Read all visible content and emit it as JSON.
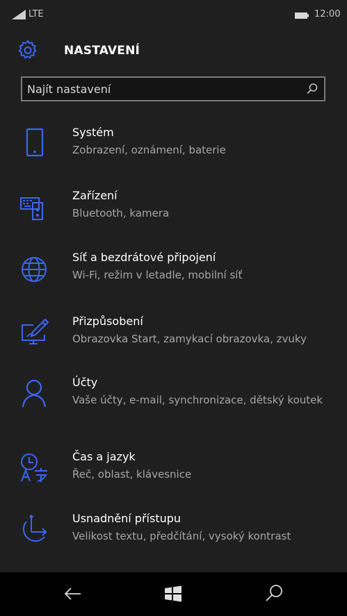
{
  "status_bar": {
    "network": "LTE",
    "time": "12:00"
  },
  "header": {
    "title": "NASTAVENÍ",
    "icon": "gear-icon"
  },
  "search": {
    "placeholder": "Najít nastavení",
    "icon": "search-icon"
  },
  "settings": [
    {
      "icon": "phone-icon",
      "title": "Systém",
      "subtitle": "Zobrazení, oznámení, baterie"
    },
    {
      "icon": "devices-icon",
      "title": "Zařízení",
      "subtitle": "Bluetooth, kamera"
    },
    {
      "icon": "globe-icon",
      "title": "Síť a bezdrátové připojení",
      "subtitle": "Wi-Fi, režim v letadle, mobilní síť"
    },
    {
      "icon": "personalize-icon",
      "title": "Přizpůsobení",
      "subtitle": "Obrazovka Start, zamykací obrazovka, zvuky"
    },
    {
      "icon": "person-icon",
      "title": "Účty",
      "subtitle": "Vaše účty, e-mail, synchronizace, dětský koutek"
    },
    {
      "icon": "time-language-icon",
      "title": "Čas a jazyk",
      "subtitle": "Řeč, oblast, klávesnice"
    },
    {
      "icon": "ease-of-access-icon",
      "title": "Usnadnění přístupu",
      "subtitle": "Velikost textu, předčítání, vysoký kontrast"
    }
  ],
  "navbar": {
    "back": "back-arrow-icon",
    "start": "windows-icon",
    "search": "search-icon"
  },
  "colors": {
    "accent": "#3b66f5",
    "background": "#1f1f1f",
    "navbar": "#000000",
    "subtitle": "#a6a6a6"
  }
}
